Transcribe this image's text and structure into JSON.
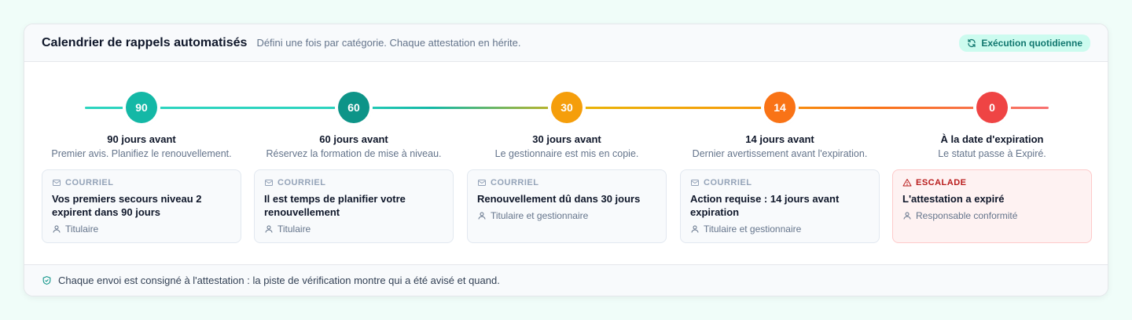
{
  "header": {
    "title": "Calendrier de rappels automatisés",
    "subtitle": "Défini une fois par catégorie. Chaque attestation en hérite.",
    "badge": "Exécution quotidienne"
  },
  "steps": [
    {
      "days": "90",
      "color": "#14b8a6",
      "title": "90 jours avant",
      "desc": "Premier avis. Planifiez le renouvellement.",
      "channel": "COURRIEL",
      "message": "Vos premiers secours niveau 2 expirent dans 90 jours",
      "recipient": "Titulaire"
    },
    {
      "days": "60",
      "color": "#0d9488",
      "title": "60 jours avant",
      "desc": "Réservez la formation de mise à niveau.",
      "channel": "COURRIEL",
      "message": "Il est temps de planifier votre renouvellement",
      "recipient": "Titulaire"
    },
    {
      "days": "30",
      "color": "#f59e0b",
      "title": "30 jours avant",
      "desc": "Le gestionnaire est mis en copie.",
      "channel": "COURRIEL",
      "message": "Renouvellement dû dans 30 jours",
      "recipient": "Titulaire et gestionnaire"
    },
    {
      "days": "14",
      "color": "#f97316",
      "title": "14 jours avant",
      "desc": "Dernier avertissement avant l'expiration.",
      "channel": "COURRIEL",
      "message": "Action requise : 14 jours avant expiration",
      "recipient": "Titulaire et gestionnaire"
    },
    {
      "days": "0",
      "color": "#ef4444",
      "title": "À la date d'expiration",
      "desc": "Le statut passe à Expiré.",
      "channel": "ESCALADE",
      "message": "L'attestation a expiré",
      "recipient": "Responsable conformité"
    }
  ],
  "footer": {
    "text": "Chaque envoi est consigné à l'attestation : la piste de vérification montre qui a été avisé et quand."
  },
  "colors": {
    "accent": "#14b8a6",
    "alert": "#b91c1c"
  },
  "icons": {
    "badge": "refresh-icon",
    "email": "mail-icon",
    "escalation": "warning-icon",
    "recipient": "user-icon",
    "footer": "shield-check-icon"
  }
}
